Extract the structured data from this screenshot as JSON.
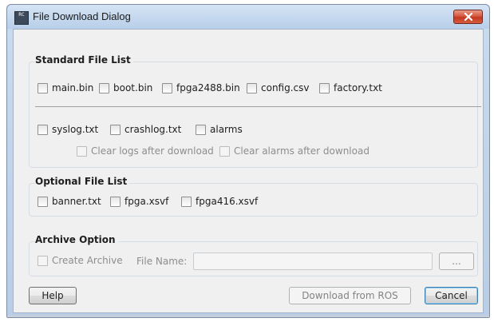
{
  "window": {
    "title": "File Download Dialog",
    "icon_text": "RC",
    "icon_name": "app-icon",
    "close_icon": "close-icon"
  },
  "standard": {
    "legend": "Standard File List",
    "row1": [
      "main.bin",
      "boot.bin",
      "fpga2488.bin",
      "config.csv",
      "factory.txt"
    ],
    "row2": [
      "syslog.txt",
      "crashlog.txt",
      "alarms"
    ],
    "clear_logs": "Clear logs after download",
    "clear_alarms": "Clear alarms after download"
  },
  "optional": {
    "legend": "Optional File List",
    "items": [
      "banner.txt",
      "fpga.xsvf",
      "fpga416.xsvf"
    ]
  },
  "archive": {
    "legend": "Archive Option",
    "create_archive": "Create Archive",
    "file_name_label": "File Name:",
    "file_name_value": "",
    "browse_label": "..."
  },
  "buttons": {
    "help": "Help",
    "download": "Download from ROS",
    "cancel": "Cancel"
  },
  "colors": {
    "close_button": "#c3381f",
    "title_bar": "#c3d7ee",
    "client_bg": "#f0f0f0"
  }
}
